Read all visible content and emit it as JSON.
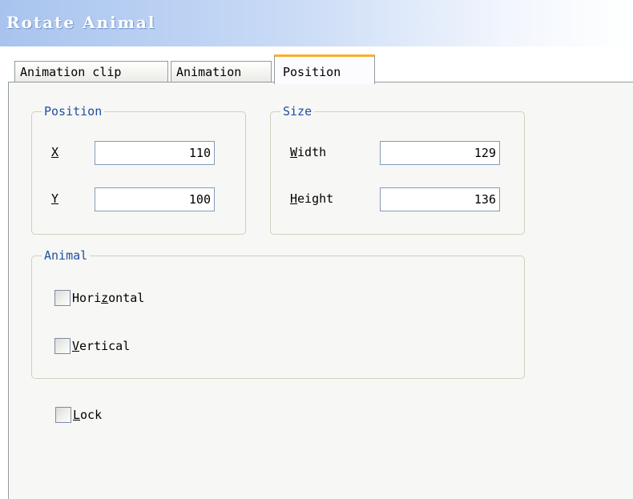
{
  "window": {
    "title": "Rotate Animal"
  },
  "tabs": [
    {
      "label": "Animation clip"
    },
    {
      "label": "Animation"
    },
    {
      "label": "Position"
    }
  ],
  "position_group": {
    "legend": "Position",
    "x": {
      "mnemonic": "X",
      "value": "110"
    },
    "y": {
      "mnemonic": "Y",
      "value": "100"
    }
  },
  "size_group": {
    "legend": "Size",
    "width": {
      "mnemonic": "W",
      "rest": "idth",
      "value": "129"
    },
    "height": {
      "mnemonic": "H",
      "rest": "eight",
      "value": "136"
    }
  },
  "animal_group": {
    "legend": "Animal",
    "horizontal": {
      "pre": "Hori",
      "mnemonic": "z",
      "post": "ontal",
      "checked": false
    },
    "vertical": {
      "mnemonic": "V",
      "post": "ertical",
      "checked": false
    }
  },
  "lock": {
    "mnemonic": "L",
    "post": "ock",
    "checked": false
  }
}
